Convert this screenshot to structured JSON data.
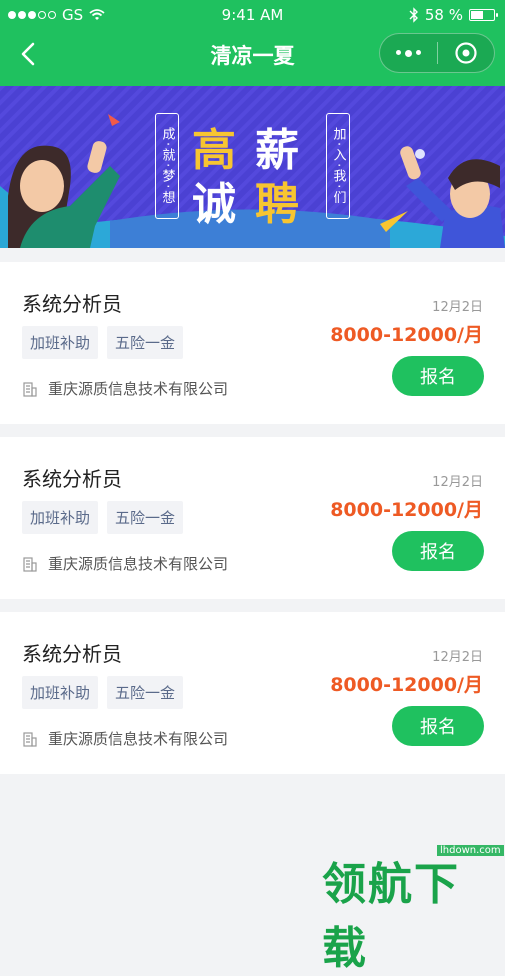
{
  "status_bar": {
    "carrier": "GS",
    "time": "9:41 AM",
    "battery_percent": "58 %",
    "battery_level": 0.58
  },
  "navbar": {
    "title": "清凉一夏"
  },
  "banner": {
    "headline": [
      "高",
      "薪",
      "诚",
      "聘"
    ],
    "left_slogan": "成·就·梦·想",
    "right_slogan": "加·入·我·们"
  },
  "jobs": [
    {
      "title": "系统分析员",
      "tags": [
        "加班补助",
        "五险一金"
      ],
      "company": "重庆源质信息技术有限公司",
      "date": "12月2日",
      "salary": "8000-12000/月",
      "apply_label": "报名"
    },
    {
      "title": "系统分析员",
      "tags": [
        "加班补助",
        "五险一金"
      ],
      "company": "重庆源质信息技术有限公司",
      "date": "12月2日",
      "salary": "8000-12000/月",
      "apply_label": "报名"
    },
    {
      "title": "系统分析员",
      "tags": [
        "加班补助",
        "五险一金"
      ],
      "company": "重庆源质信息技术有限公司",
      "date": "12月2日",
      "salary": "8000-12000/月",
      "apply_label": "报名"
    }
  ],
  "watermark": {
    "site": "lhdown.com",
    "brand": "领航下载"
  },
  "colors": {
    "primary_green": "#1fc15f",
    "salary_orange": "#ee5a24",
    "banner_purple": "#4f45d8",
    "headline_yellow": "#f7c531"
  }
}
